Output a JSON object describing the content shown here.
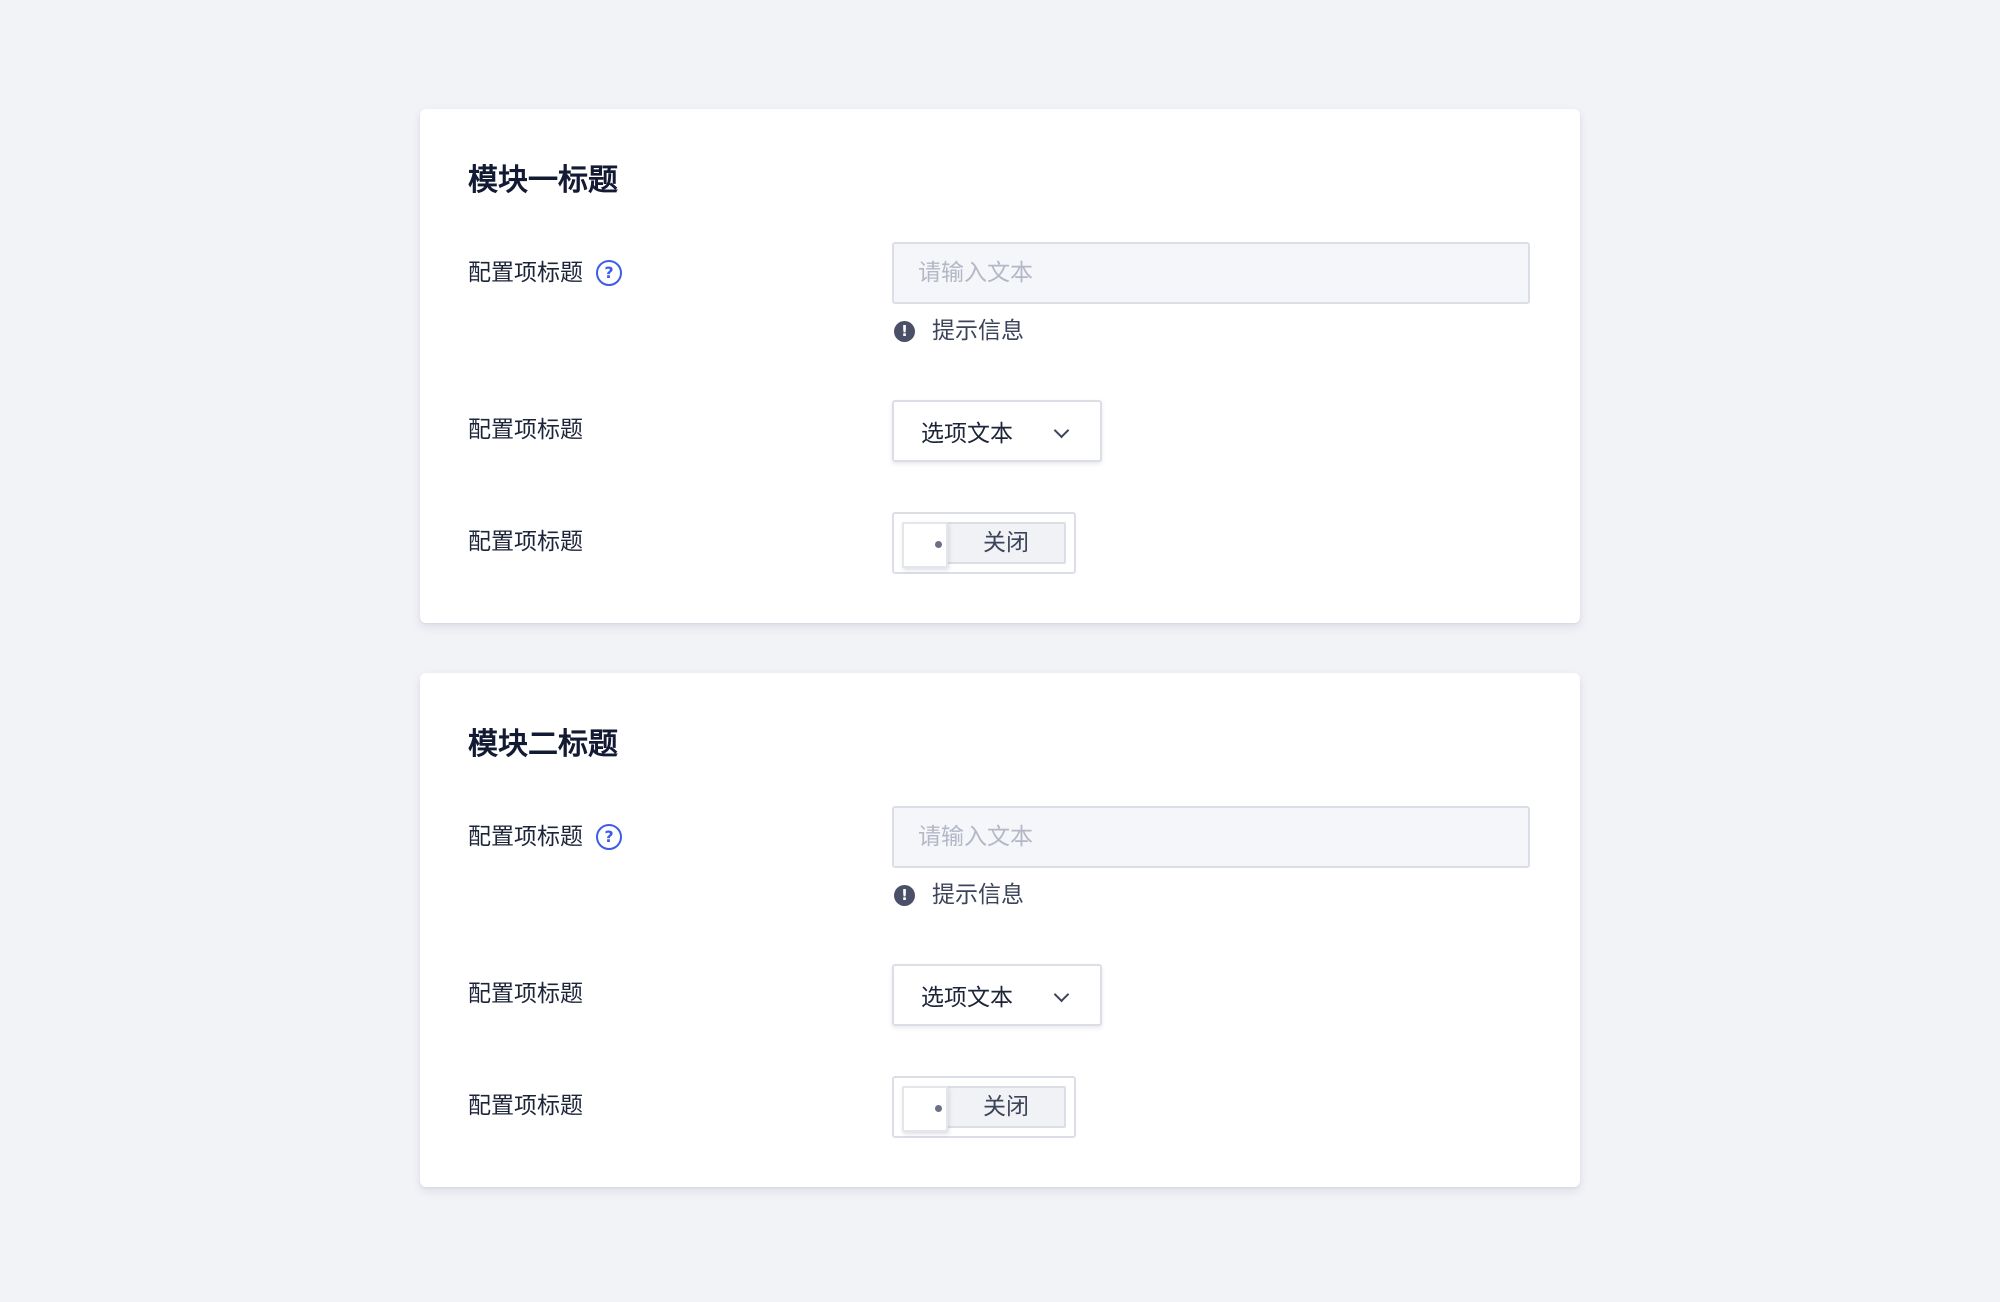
{
  "modules": [
    {
      "title": "模块一标题",
      "rows": [
        {
          "label": "配置项标题",
          "help_icon": "question-circle-icon",
          "placeholder": "请输入文本",
          "value": "",
          "hint": "提示信息",
          "hint_icon": "exclamation-circle-icon"
        },
        {
          "label": "配置项标题",
          "select_value": "选项文本",
          "select_icon": "chevron-down-icon"
        },
        {
          "label": "配置项标题",
          "switch_label": "关闭",
          "switch_on": false
        }
      ]
    },
    {
      "title": "模块二标题",
      "rows": [
        {
          "label": "配置项标题",
          "help_icon": "question-circle-icon",
          "placeholder": "请输入文本",
          "value": "",
          "hint": "提示信息",
          "hint_icon": "exclamation-circle-icon"
        },
        {
          "label": "配置项标题",
          "select_value": "选项文本",
          "select_icon": "chevron-down-icon"
        },
        {
          "label": "配置项标题",
          "switch_label": "关闭",
          "switch_on": false
        }
      ]
    }
  ],
  "glyphs": {
    "help": "?",
    "hint": "!"
  },
  "colors": {
    "background": "#f2f3f7",
    "card": "#ffffff",
    "accent": "#3d5ce8",
    "title_text": "#131a33",
    "body_text": "#1c2438",
    "placeholder": "#b4b8c6",
    "border": "#dcdee6"
  }
}
